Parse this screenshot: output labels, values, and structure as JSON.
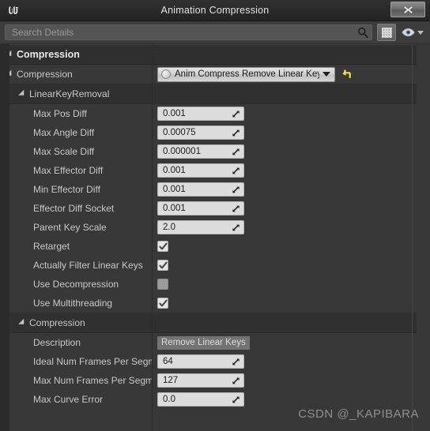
{
  "window": {
    "title": "Animation Compression",
    "logo_glyph": "U",
    "close_label": "✕"
  },
  "toolbar": {
    "search_placeholder": "Search Details",
    "search_icon": "search-icon",
    "grid_button_name": "column-view-button",
    "eye_button_name": "view-options-button"
  },
  "panel": {
    "rows": [
      {
        "kind": "category",
        "label": "Compression",
        "indent": 10,
        "expanded": true
      },
      {
        "kind": "group_combo",
        "label": "Compression",
        "indent": 10,
        "expanded": true,
        "combo": {
          "value": "Anim Compress Remove Linear Keys",
          "reset_icon": "reset-arrow-icon"
        }
      },
      {
        "kind": "group",
        "label": "LinearKeyRemoval",
        "indent": 26,
        "expanded": true
      },
      {
        "kind": "number",
        "label": "Max Pos Diff",
        "indent": 42,
        "value": "0.001"
      },
      {
        "kind": "number",
        "label": "Max Angle Diff",
        "indent": 42,
        "value": "0.00075"
      },
      {
        "kind": "number",
        "label": "Max Scale Diff",
        "indent": 42,
        "value": "0.000001"
      },
      {
        "kind": "number",
        "label": "Max Effector Diff",
        "indent": 42,
        "value": "0.001"
      },
      {
        "kind": "number",
        "label": "Min Effector Diff",
        "indent": 42,
        "value": "0.001"
      },
      {
        "kind": "number",
        "label": "Effector Diff Socket",
        "indent": 42,
        "value": "0.001"
      },
      {
        "kind": "number",
        "label": "Parent Key Scale",
        "indent": 42,
        "value": "2.0"
      },
      {
        "kind": "checkbox",
        "label": "Retarget",
        "indent": 42,
        "checked": true
      },
      {
        "kind": "checkbox",
        "label": "Actually Filter Linear Keys",
        "indent": 42,
        "checked": true
      },
      {
        "kind": "checkbox",
        "label": "Use Decompression",
        "indent": 42,
        "checked": false
      },
      {
        "kind": "checkbox",
        "label": "Use Multithreading",
        "indent": 42,
        "checked": true
      },
      {
        "kind": "group",
        "label": "Compression",
        "indent": 26,
        "expanded": true
      },
      {
        "kind": "text",
        "label": "Description",
        "indent": 42,
        "value": "Remove Linear Keys"
      },
      {
        "kind": "number",
        "label": "Ideal Num Frames Per Segment",
        "indent": 42,
        "value": "64"
      },
      {
        "kind": "number",
        "label": "Max Num Frames Per Segment",
        "indent": 42,
        "value": "127"
      },
      {
        "kind": "number",
        "label": "Max Curve Error",
        "indent": 42,
        "value": "0.0"
      }
    ]
  },
  "watermark": "CSDN @_KAPIBARA",
  "colors": {
    "panel_bg": "#383838",
    "row_header_bg": "#2f2f2f",
    "field_bg": "#dcdcdc",
    "accent_reset": "#f5e23c",
    "text": "#c8c8c8"
  }
}
